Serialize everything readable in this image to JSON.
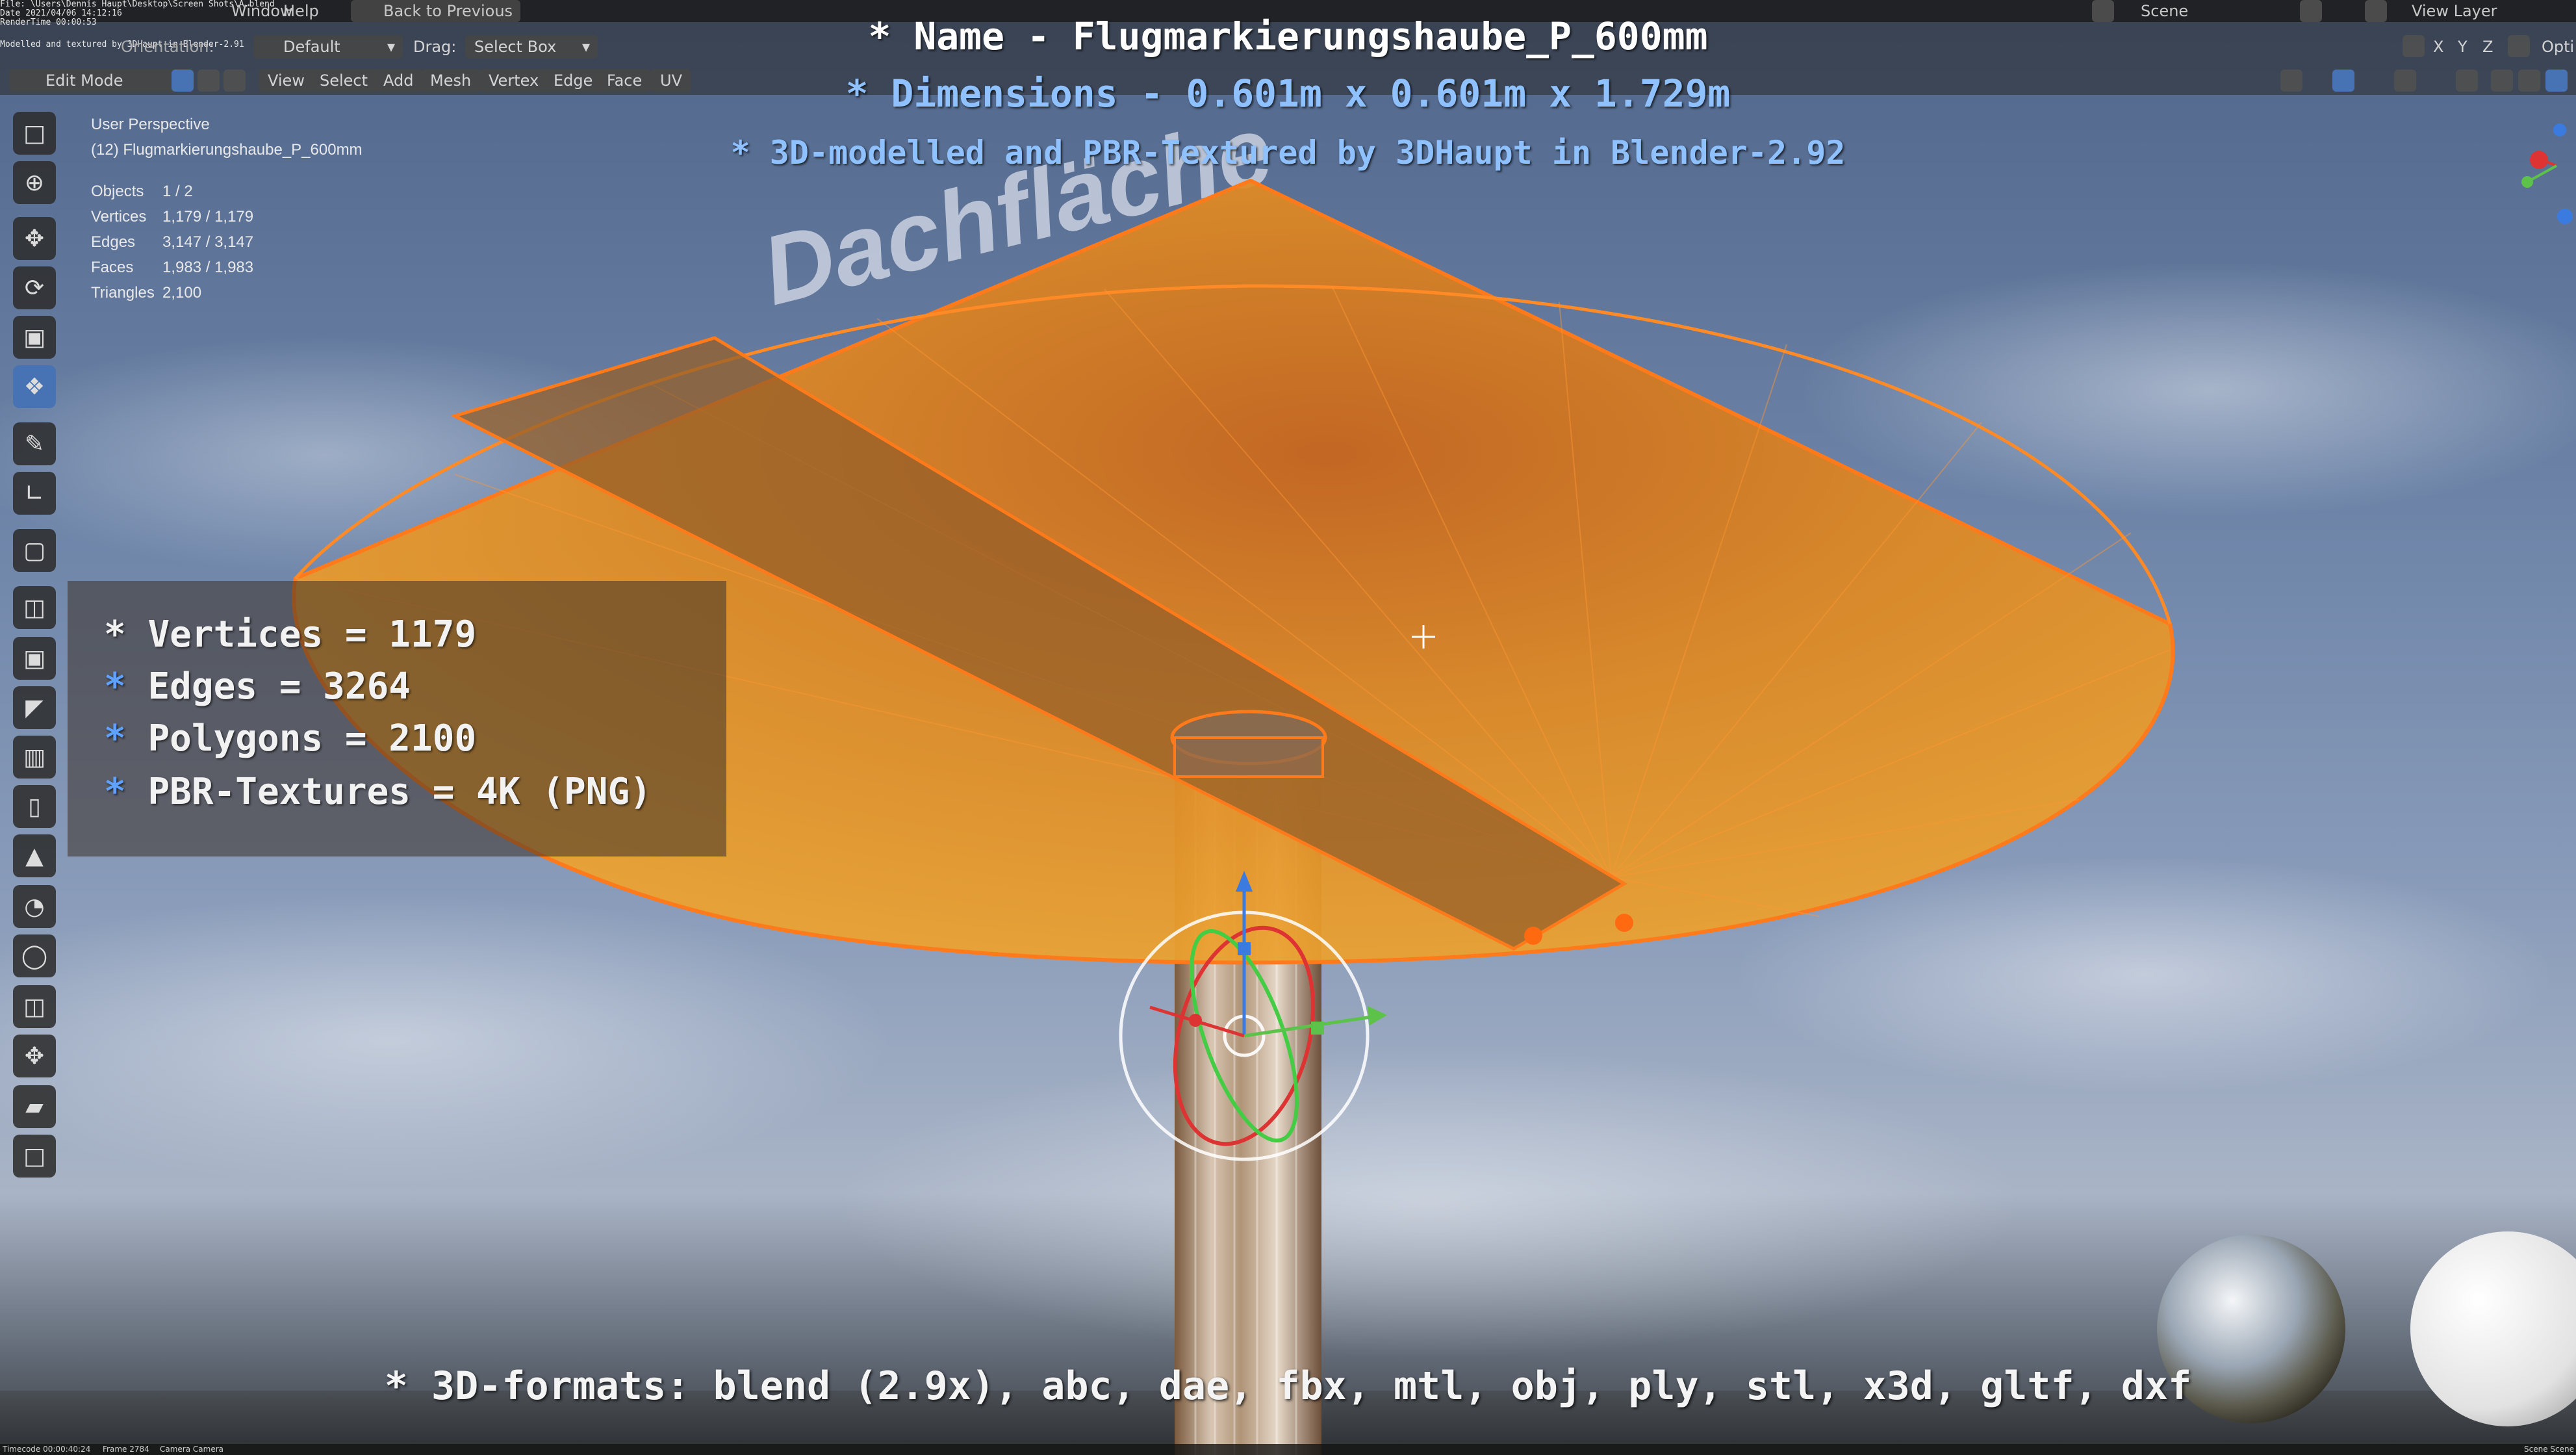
{
  "window": {
    "file_path_line": "File: \\Users\\Dennis Haupt\\Desktop\\Screen Shots\\A.blend",
    "date_line": "Date 2021/04/06 14:12:16",
    "render_time_line": "RenderTime 00:00:53",
    "modelled_line": "Modelled and textured by 3DHaupt in Blender-2.91"
  },
  "menubar": {
    "window_label": "Window",
    "help_label": "Help",
    "back_to_previous_label": "Back to Previous",
    "scene_label": "Scene",
    "view_layer_label": "View Layer",
    "options_label": "Opti"
  },
  "header": {
    "orientation_label": "Orientation:",
    "orientation_value": "Default",
    "drag_label": "Drag:",
    "drag_value": "Select Box",
    "mode_label": "Edit Mode",
    "menus": [
      "View",
      "Select",
      "Add",
      "Mesh",
      "Vertex",
      "Edge",
      "Face",
      "UV"
    ],
    "axis_toggles": [
      "X",
      "Y",
      "Z"
    ]
  },
  "viewport_info": {
    "perspective": "User Perspective",
    "object_name": "(12) Flugmarkierungshaube_P_600mm",
    "stats": [
      {
        "label": "Objects",
        "value": "1 / 2"
      },
      {
        "label": "Vertices",
        "value": "1,179 / 1,179"
      },
      {
        "label": "Edges",
        "value": "3,147 / 3,147"
      },
      {
        "label": "Faces",
        "value": "1,983 / 1,983"
      },
      {
        "label": "Triangles",
        "value": "2,100"
      }
    ]
  },
  "annotation": {
    "name_line": "* Name - Flugmarkierungshaube_P_600mm",
    "dimensions_line": "* Dimensions - 0.601m x 0.601m x 1.729m",
    "credit_line": "* 3D-modelled and PBR-Textured by 3DHaupt in Blender-2.92",
    "info_lines": [
      {
        "star": "*",
        "text": "Vertices = 1179"
      },
      {
        "star": "*",
        "text": "Edges = 3264"
      },
      {
        "star": "*",
        "text": "Polygons = 2100"
      },
      {
        "star": "*",
        "text": "PBR-Textures = 4K (PNG)"
      }
    ],
    "formats_line": "* 3D-formats: blend (2.9x), abc, dae, fbx, mtl, obj, ply, stl, x3d, gltf, dxf"
  },
  "scene": {
    "roof_text": "Dachfläche"
  },
  "statusbar": {
    "timecode": "Timecode 00:00:40:24",
    "frame": "Frame 2784",
    "camera": "Camera Camera",
    "scene_right": "Scene Scene"
  },
  "colors": {
    "accent_blue": "#4772b3",
    "hood_orange": "#e89a1c",
    "wire_orange": "#ff7a1a",
    "dimension_blue": "#8fc1ff"
  },
  "icons": {
    "tools": [
      "select-box-icon",
      "cursor-icon",
      "move-icon",
      "rotate-icon",
      "scale-icon",
      "transform-icon",
      "annotate-icon",
      "measure-icon",
      "add-cube-icon",
      "extrude-region-icon",
      "inset-faces-icon",
      "bevel-icon",
      "loop-cut-icon",
      "knife-icon",
      "poly-build-icon",
      "spin-icon",
      "smooth-icon",
      "edge-slide-icon",
      "shrink-fatten-icon",
      "shear-icon",
      "rip-region-icon"
    ]
  }
}
